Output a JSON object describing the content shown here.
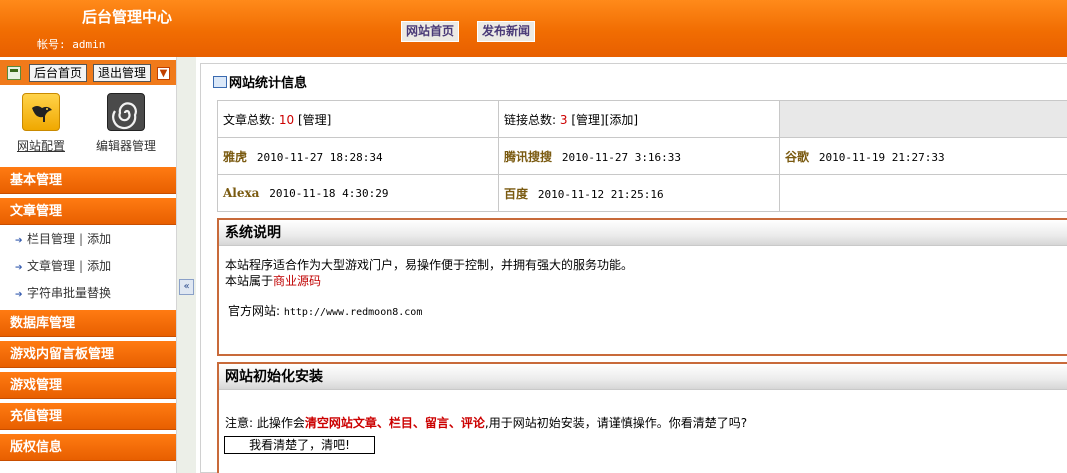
{
  "header": {
    "title": "后台管理中心",
    "account": "帐号: admin",
    "nav": {
      "home": "网站首页",
      "publish_news": "发布新闻"
    }
  },
  "sidebar": {
    "toolbar": {
      "admin_home": "后台首页",
      "logout": "退出管理"
    },
    "quick_links": [
      {
        "label": "网站配置",
        "icon": "bird-icon"
      },
      {
        "label": "编辑器管理",
        "icon": "spiral-icon"
      }
    ],
    "menus": [
      "基本管理",
      "文章管理",
      "数据库管理",
      "游戏内留言板管理",
      "游戏管理",
      "充值管理",
      "版权信息"
    ],
    "article_items": {
      "column_manage": "栏目管理",
      "column_add": "添加",
      "article_manage": "文章管理",
      "article_add": "添加",
      "string_replace": "字符串批量替换",
      "separator": "|"
    }
  },
  "main": {
    "stats": {
      "title": "网站统计信息",
      "article_label": "文章总数:",
      "article_count": "10",
      "manage": "[管理]",
      "link_label": "链接总数:",
      "link_count": "3",
      "link_manage": "[管理]",
      "link_add": "[添加]",
      "engines": [
        {
          "name": "雅虎",
          "time": "2010-11-27 18:28:34"
        },
        {
          "name": "腾讯搜搜",
          "time": "2010-11-27 3:16:33"
        },
        {
          "name": "谷歌",
          "time": "2010-11-19 21:27:33"
        },
        {
          "name": "Alexa",
          "time": "2010-11-18 4:30:29"
        },
        {
          "name": "百度",
          "time": "2010-11-12 21:25:16"
        }
      ]
    },
    "system": {
      "title": "系统说明",
      "line1": "本站程序适合作为大型游戏门户，易操作便于控制，并拥有强大的服务功能。",
      "line2_prefix": "本站属于",
      "line2_link": "商业源码",
      "site_label": "官方网站:",
      "site_url": "http://www.redmoon8.com"
    },
    "init": {
      "title": "网站初始化安装",
      "notice_prefix": "注意: 此操作会",
      "notice_warn": "清空网站文章、栏目、留言、评论",
      "notice_suffix": ",用于网站初始安装，请谨慎操作。你看清楚了吗?",
      "confirm_button": "我看清楚了，清吧!"
    }
  },
  "colors": {
    "accent": "#f16d02",
    "link_red": "#cc0000",
    "engine": "#7a5a10"
  }
}
